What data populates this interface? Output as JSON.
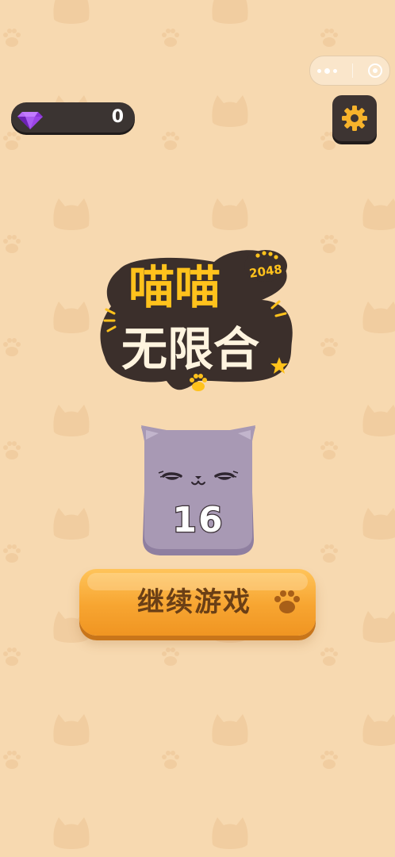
{
  "topbar": {
    "capsule": {
      "more_icon": "more-dots-icon",
      "close_icon": "target-circle-icon"
    },
    "gems": {
      "icon": "purple-diamond-icon",
      "count": "0"
    },
    "settings": {
      "icon": "gear-icon"
    }
  },
  "logo": {
    "line1": "喵喵",
    "line2": "无限合",
    "badge": "2048",
    "star_icon": "star-icon",
    "paw_icon": "paw-icon"
  },
  "current_tile": {
    "value": "16",
    "icon": "sleepy-cat-face",
    "color": "#a899b4"
  },
  "continue_button": {
    "label": "继续游戏",
    "icon": "paw-icon"
  },
  "colors": {
    "background": "#f7d9b0",
    "button_orange": "#f7a531",
    "dark_panel": "#3b3432",
    "logo_yellow": "#ffc21c",
    "logo_cream": "#fff4df"
  }
}
